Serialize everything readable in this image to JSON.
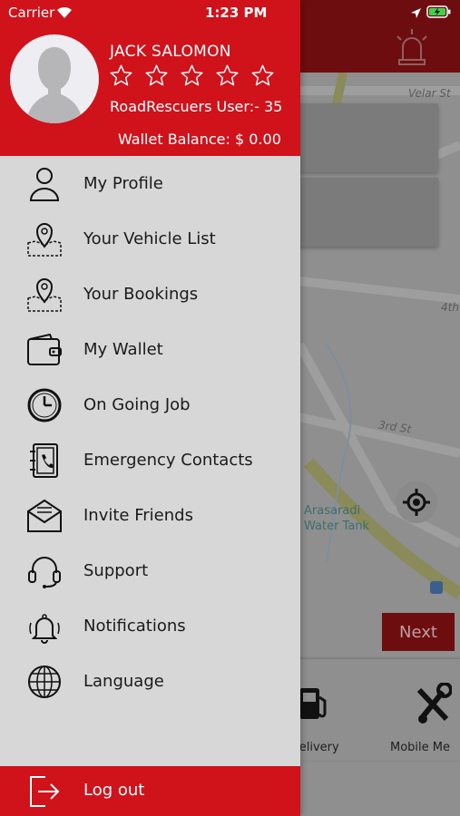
{
  "status_bar": {
    "carrier": "Carrier",
    "time": "1:23 PM",
    "wifi_icon": "wifi-icon",
    "location_icon": "location-arrow-icon",
    "battery_icon": "battery-charging-icon"
  },
  "drawer": {
    "user": {
      "name": "JACK SALOMON",
      "rating_stars": 5,
      "rating_filled": 0,
      "user_line": "RoadRescuers User:- 35",
      "wallet_line": "Wallet Balance: $ 0.00"
    },
    "menu": [
      {
        "label": "My Profile",
        "icon": "user-icon"
      },
      {
        "label": "Your Vehicle List",
        "icon": "map-pin-icon"
      },
      {
        "label": "Your Bookings",
        "icon": "map-pin-icon"
      },
      {
        "label": "My Wallet",
        "icon": "wallet-icon"
      },
      {
        "label": "On Going Job",
        "icon": "clock-icon"
      },
      {
        "label": "Emergency Contacts",
        "icon": "address-book-icon"
      },
      {
        "label": "Invite Friends",
        "icon": "envelope-icon"
      },
      {
        "label": "Support",
        "icon": "headset-icon"
      },
      {
        "label": "Notifications",
        "icon": "bell-icon"
      },
      {
        "label": "Language",
        "icon": "globe-icon"
      }
    ],
    "logout": {
      "label": "Log out",
      "icon": "logout-icon"
    }
  },
  "background": {
    "map_labels": [
      "Velar St",
      "4th",
      "3rd St",
      "Arasaradi\nWater Tank"
    ],
    "next_label": "Next",
    "services": [
      {
        "label": "l Delivery",
        "icon": "fuel-pump-icon"
      },
      {
        "label": "Mobile Me",
        "icon": "wrench-icon"
      }
    ]
  },
  "colors": {
    "brand_red": "#d0121b",
    "drawer_bg": "#d7d7d7",
    "overlay_header": "#6e0d10"
  }
}
